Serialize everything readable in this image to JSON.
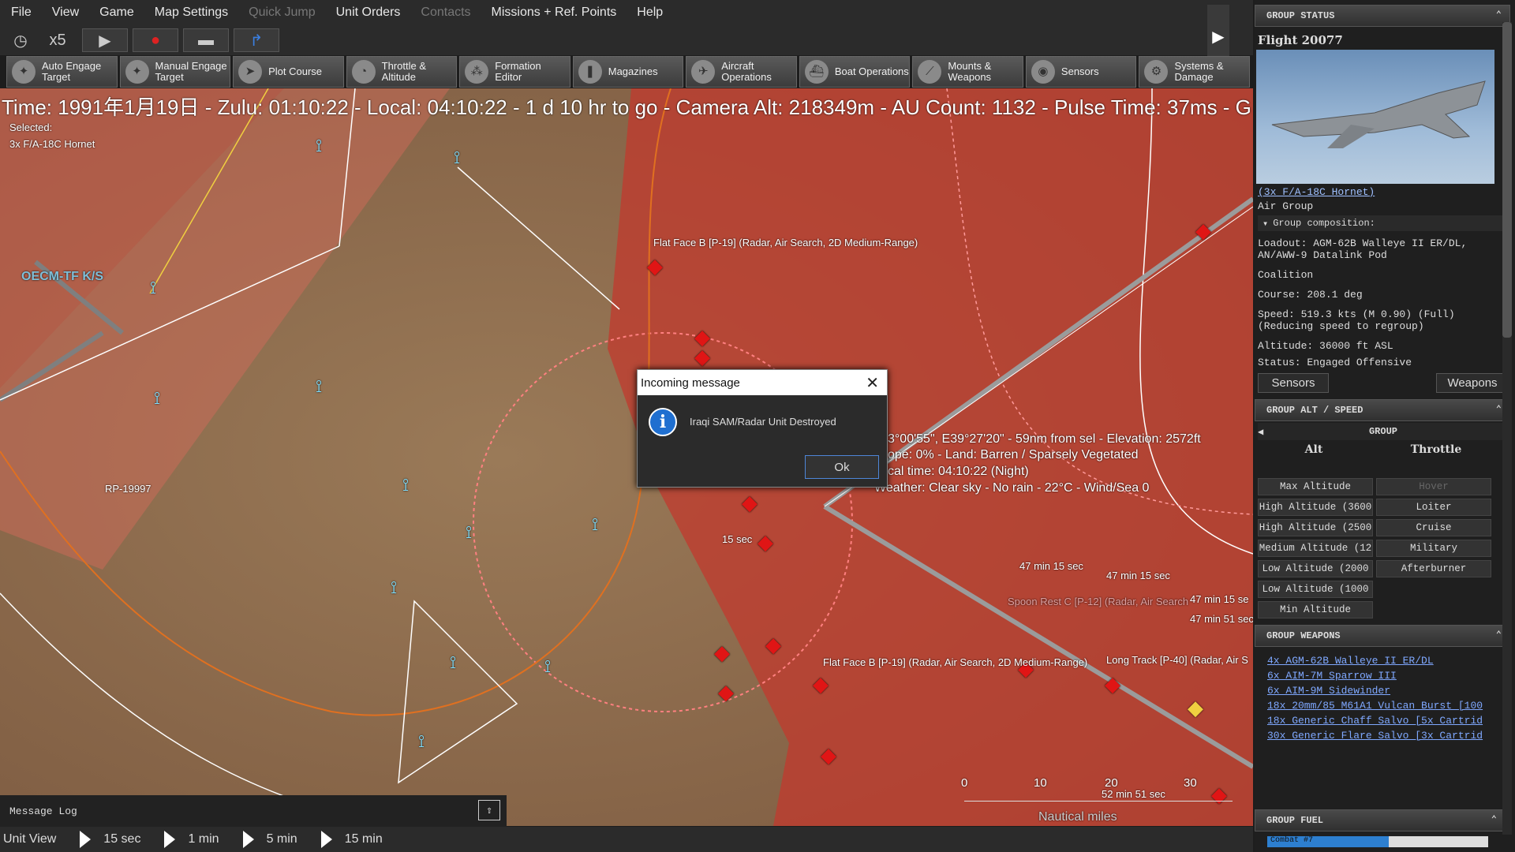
{
  "menu": {
    "items": [
      "File",
      "View",
      "Game",
      "Map Settings",
      "Quick Jump",
      "Unit Orders",
      "Contacts",
      "Missions + Ref. Points",
      "Help"
    ]
  },
  "time_controls": {
    "speed": "x5"
  },
  "command_bar": {
    "buttons": [
      "Auto Engage Target",
      "Manual Engage Target",
      "Plot Course",
      "Throttle & Altitude",
      "Formation Editor",
      "Magazines",
      "Aircraft Operations",
      "Boat Operations",
      "Mounts & Weapons",
      "Sensors",
      "Systems & Damage"
    ]
  },
  "status_line": "Time: 1991年1月19日 - Zulu: 01:10:22 - Local: 04:10:22 - 1 d 10 hr to go -  Camera Alt: 218349m  - AU Count: 1132 - Pulse Time: 37ms - G",
  "selection": {
    "title": "Selected:",
    "unit": "3x F/A-18C Hornet"
  },
  "map_labels": {
    "oecm": "OECM-TF K/S",
    "rp": "RP-19997",
    "flat_face_top": "Flat Face B [P-19] (Radar, Air Search, 2D Medium-Range)",
    "flat_face_bottom": "Flat Face B [P-19] (Radar, Air Search, 2D Medium-Range)",
    "spoon_rest": "Spoon Rest C [P-12] (Radar, Air Search",
    "long_track": "Long Track [P-40] (Radar, Air S",
    "t1": "47 min 15 sec",
    "t2": "47 min 15 sec",
    "t3": "47 min 15 se",
    "t4": "47 min 51 sec",
    "t5": "52 min 51 sec",
    "t6": "15 sec",
    "scale_unit": "Nautical miles",
    "scale": [
      "0",
      "10",
      "20",
      "30"
    ],
    "cursor_info": [
      "3°00'55\", E39°27'20\" - 59nm from sel - Elevation: 2572ft",
      "ope: 0%  - Land: Barren / Sparsely Vegetated",
      "cal time: 04:10:22 (Night)",
      "Weather: Clear sky - No rain - 22°C - Wind/Sea 0"
    ]
  },
  "dialog": {
    "title": "Incoming message",
    "message": "Iraqi SAM/Radar Unit Destroyed",
    "ok": "Ok"
  },
  "message_log": {
    "label": "Message Log"
  },
  "time_compression": {
    "unit_view": "Unit View",
    "options": [
      "15 sec",
      "1 min",
      "5 min",
      "15 min"
    ]
  },
  "right_panel": {
    "group_status": {
      "header": "GROUP STATUS",
      "flight": "Flight 20077",
      "unit_link": "(3x F/A-18C Hornet)",
      "type": "Air Group",
      "composition": "Group composition:",
      "loadout": "Loadout: AGM-62B Walleye II ER/DL, AN/AWW-9 Datalink Pod",
      "side": "Coalition",
      "course": "Course: 208.1 deg",
      "speed": "Speed: 519.3 kts (M 0.90) (Full)",
      "speed_note": "(Reducing speed to regroup)",
      "altitude": "Altitude: 36000 ft ASL",
      "status": "Status: Engaged Offensive",
      "sensors_btn": "Sensors",
      "weapons_btn": "Weapons"
    },
    "alt_speed": {
      "header": "GROUP ALT / SPEED",
      "group": "GROUP",
      "alt": "Alt",
      "throttle": "Throttle",
      "alt_buttons": [
        "Max Altitude",
        "High Altitude (3600",
        "High Altitude (2500",
        "Medium Altitude (12",
        "Low Altitude (2000",
        "Low Altitude (1000",
        "Min Altitude"
      ],
      "throttle_buttons": [
        "Hover",
        "Loiter",
        "Cruise",
        "Military",
        "Afterburner"
      ]
    },
    "weapons": {
      "header": "GROUP WEAPONS",
      "items": [
        "4x AGM-62B Walleye II ER/DL",
        "6x AIM-7M Sparrow III",
        "6x AIM-9M Sidewinder",
        "18x 20mm/85 M61A1 Vulcan Burst [100",
        "18x Generic Chaff Salvo [5x Cartrid",
        "30x Generic Flare Salvo [3x Cartrid"
      ]
    },
    "fuel": {
      "header": "GROUP FUEL",
      "bar_label": "Combat #7",
      "fill": 0.55
    }
  },
  "colors": {
    "hostile": "#e01515",
    "friendly": "#7fe0ff",
    "zone": "#c2392d"
  }
}
